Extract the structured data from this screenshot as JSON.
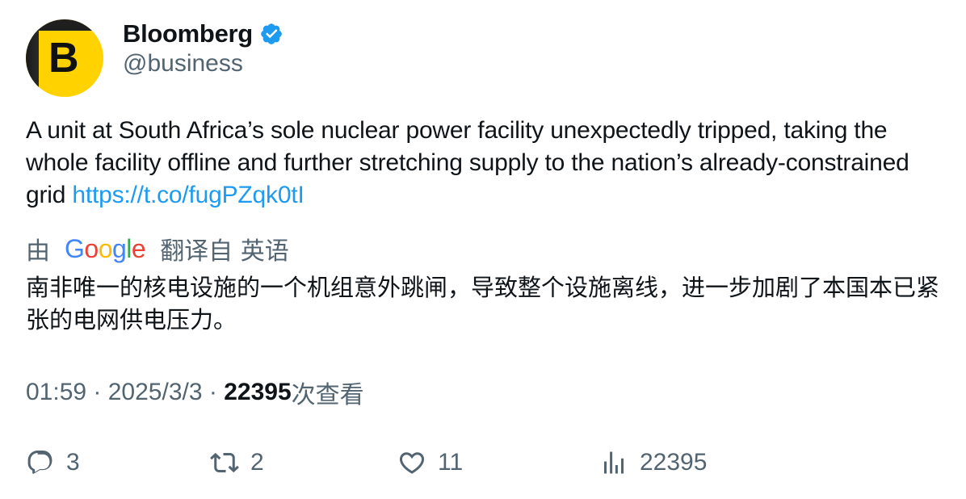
{
  "author": {
    "display_name": "Bloomberg",
    "handle": "@business",
    "avatar_letter": "B",
    "verified_color": "#1d9bf0"
  },
  "tweet": {
    "text": "A unit at South Africa’s sole nuclear power facility unexpectedly tripped, taking the whole facility offline and further stretching supply to the nation’s already-constrained grid ",
    "link": "https://t.co/fugPZqk0tI"
  },
  "translation": {
    "prefix": "由",
    "logo_letters": [
      "G",
      "o",
      "o",
      "g",
      "l",
      "e"
    ],
    "suffix": "翻译自 英语",
    "text": "南非唯一的核电设施的一个机组意外跳闸，导致整个设施离线，进一步加剧了本国本已紧张的电网供电压力。"
  },
  "meta": {
    "time": "01:59",
    "separator": " · ",
    "date": "2025/3/3",
    "views_count": "22395",
    "views_label": "次查看"
  },
  "actions": {
    "reply_count": "3",
    "retweet_count": "2",
    "like_count": "11",
    "views_count": "22395"
  },
  "icons": {
    "reply": "reply-icon",
    "retweet": "retweet-icon",
    "like": "heart-icon",
    "views": "analytics-icon",
    "verified": "verified-badge-icon"
  }
}
